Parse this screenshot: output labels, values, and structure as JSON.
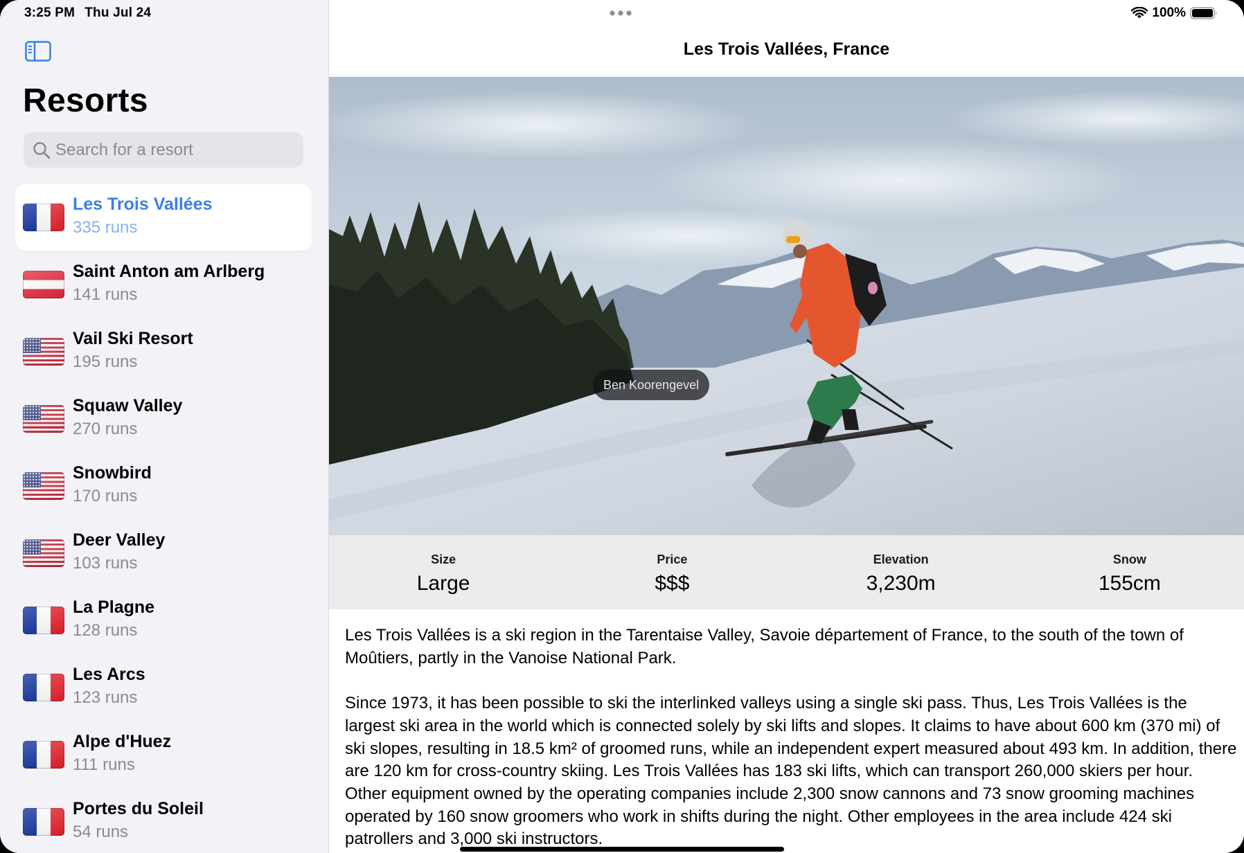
{
  "status_bar": {
    "time": "3:25 PM",
    "date": "Thu Jul 24",
    "battery": "100%"
  },
  "sidebar": {
    "title": "Resorts",
    "search": {
      "placeholder": "Search for a resort",
      "value": ""
    },
    "resorts": [
      {
        "name": "Les Trois Vallées",
        "runs": "335 runs",
        "flag": "fr",
        "selected": true
      },
      {
        "name": "Saint Anton am Arlberg",
        "runs": "141 runs",
        "flag": "at",
        "selected": false
      },
      {
        "name": "Vail Ski Resort",
        "runs": "195 runs",
        "flag": "us",
        "selected": false
      },
      {
        "name": "Squaw Valley",
        "runs": "270 runs",
        "flag": "us",
        "selected": false
      },
      {
        "name": "Snowbird",
        "runs": "170 runs",
        "flag": "us",
        "selected": false
      },
      {
        "name": "Deer Valley",
        "runs": "103 runs",
        "flag": "us",
        "selected": false
      },
      {
        "name": "La Plagne",
        "runs": "128 runs",
        "flag": "fr",
        "selected": false
      },
      {
        "name": "Les Arcs",
        "runs": "123 runs",
        "flag": "fr",
        "selected": false
      },
      {
        "name": "Alpe d'Huez",
        "runs": "111 runs",
        "flag": "fr",
        "selected": false
      },
      {
        "name": "Portes du Soleil",
        "runs": "54 runs",
        "flag": "fr",
        "selected": false
      }
    ]
  },
  "detail": {
    "title": "Les Trois Vallées, France",
    "photo_credit": "Ben Koorengevel",
    "stats": [
      {
        "label": "Size",
        "value": "Large"
      },
      {
        "label": "Price",
        "value": "$$$"
      },
      {
        "label": "Elevation",
        "value": "3,230m"
      },
      {
        "label": "Snow",
        "value": "155cm"
      }
    ],
    "description": [
      "Les Trois Vallées is a ski region in the Tarentaise Valley, Savoie département of France, to the south of the town of Moûtiers, partly in the Vanoise National Park.",
      "Since 1973, it has been possible to ski the interlinked valleys using a single ski pass. Thus, Les Trois Vallées is the largest ski area in the world which is connected solely by ski lifts and slopes. It claims to have about 600 km (370 mi) of ski slopes, resulting in 18.5 km² of groomed runs, while an independent expert measured about 493 km. In addition, there are 120 km for cross-country skiing. Les Trois Vallées has 183 ski lifts, which can transport 260,000 skiers per hour. Other equipment owned by the operating companies include 2,300 snow cannons and 73 snow grooming machines operated by 160 snow groomers who work in shifts during the night. Other employees in the area include 424 ski patrollers and 3,000 ski instructors."
    ]
  },
  "colors": {
    "accent": "#3b7ee6",
    "accent_light": "#83b1f2",
    "sidebar_bg": "#f2f2f7",
    "stats_bg": "#ececec"
  },
  "icons": {
    "sidebar_toggle": "sidebar-toggle-icon",
    "search": "magnifying-glass-icon",
    "wifi": "wifi-icon",
    "battery": "battery-icon",
    "more": "ellipsis-icon"
  }
}
